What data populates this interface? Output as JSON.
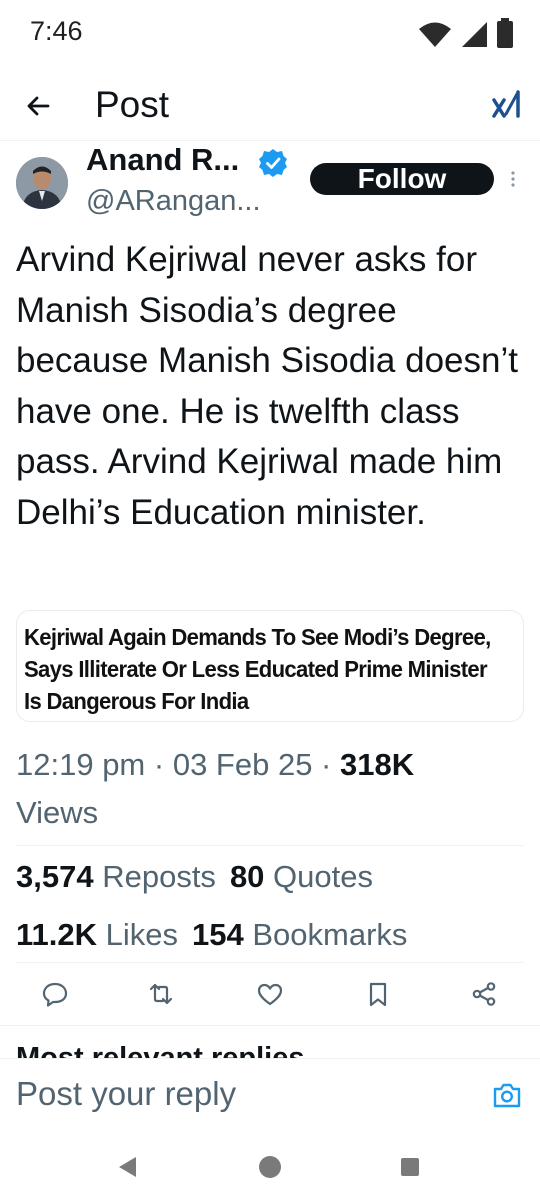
{
  "status_bar": {
    "time": "7:46",
    "icons": [
      "wifi-icon",
      "signal-icon",
      "battery-icon"
    ]
  },
  "app_bar": {
    "title": "Post",
    "icons": [
      "back-arrow-icon",
      "grok-icon"
    ]
  },
  "author": {
    "name": "Anand R...",
    "handle": "@ARangan...",
    "verified": true,
    "follow_label": "Follow"
  },
  "tweet": {
    "text": "Arvind Kejriwal never asks for Manish Sisodia’s degree because Manish Sisodia doesn’t have one. He is twelfth class pass. Arvind Kejriwal made him Delhi’s Education minister.",
    "quote_headline": "Kejriwal Again Demands To See Modi’s Degree, Says Illiterate Or Less Educated Prime Minister Is Dangerous For India"
  },
  "meta": {
    "time": "12:19 pm",
    "date": "03 Feb 25",
    "separator": " · ",
    "views_count": "318K",
    "views_label": "Views"
  },
  "stats": {
    "reposts_count": "3,574",
    "reposts_label": "Reposts",
    "quotes_count": "80",
    "quotes_label": "Quotes",
    "likes_count": "11.2K",
    "likes_label": "Likes",
    "bookmarks_count": "154",
    "bookmarks_label": "Bookmarks"
  },
  "actions": [
    "reply-icon",
    "repost-icon",
    "like-icon",
    "bookmark-icon",
    "share-icon"
  ],
  "replies_heading": "Most relevant replies ⌄",
  "reply_box": {
    "placeholder": "Post your reply"
  },
  "colors": {
    "text_primary": "#0f1419",
    "text_secondary": "#536471",
    "accent": "#1d9bf0",
    "follow_bg": "#0f1419",
    "divider": "#eff3f4"
  }
}
